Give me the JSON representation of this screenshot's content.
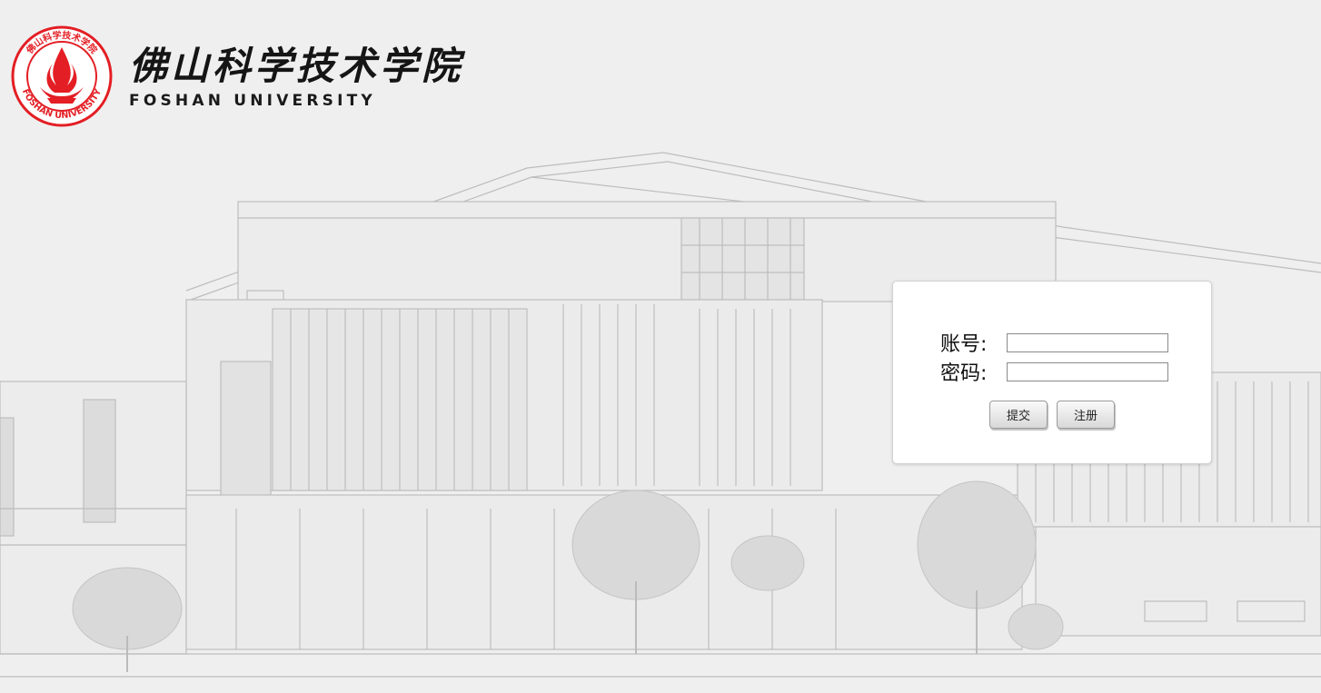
{
  "header": {
    "school_name_cn": "佛山科学技术学院",
    "school_name_en": "FOSHAN UNIVERSITY",
    "emblem_ring_text": "佛山科学技术学院",
    "emblem_bottom_text": "FOSHAN UNIVERSITY"
  },
  "login": {
    "account_label": "账号:",
    "password_label": "密码:",
    "account_value": "",
    "password_value": "",
    "submit_label": "提交",
    "register_label": "注册"
  },
  "colors": {
    "brand_red": "#e31e24",
    "background": "#efefef",
    "card": "#ffffff"
  }
}
